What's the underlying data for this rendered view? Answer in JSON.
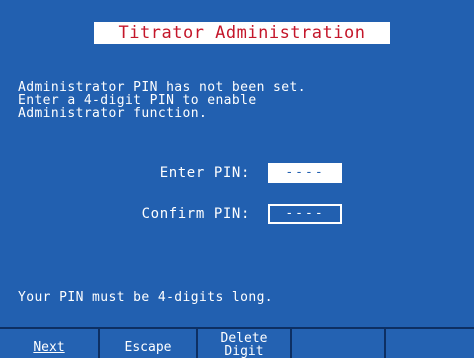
{
  "title": "Titrator Administration",
  "message_lines": [
    "Administrator PIN has not been set.",
    "Enter a 4-digit PIN to enable",
    "Administrator function."
  ],
  "enter_pin": {
    "label": "Enter PIN:",
    "value": "----"
  },
  "confirm_pin": {
    "label": "Confirm PIN:",
    "value": "----"
  },
  "footer_message": "Your PIN must be 4-digits long.",
  "softkeys": [
    {
      "label": "Next"
    },
    {
      "label": "Escape"
    },
    {
      "line1": "Delete",
      "line2": "Digit"
    },
    {
      "label": ""
    },
    {
      "label": ""
    }
  ],
  "colors": {
    "background": "#2260b0",
    "title_text": "#c4162a",
    "title_background": "#ffffff",
    "text": "#ffffff"
  }
}
